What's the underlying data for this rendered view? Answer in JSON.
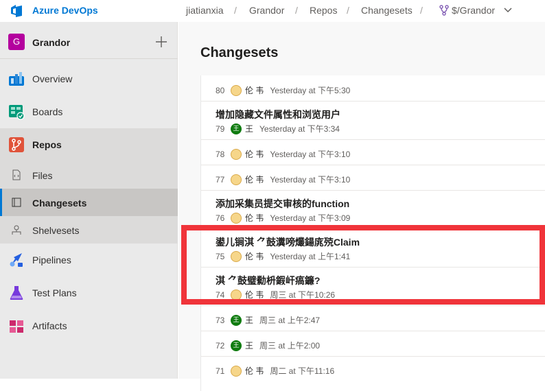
{
  "topbar": {
    "brand": "Azure DevOps",
    "breadcrumbs": [
      "jiatianxia",
      "Grandor",
      "Repos",
      "Changesets",
      "$/Grandor"
    ],
    "separator": "/"
  },
  "sidebar": {
    "project_initial": "G",
    "project_name": "Grandor",
    "items": [
      {
        "label": "Overview",
        "icon": "overview-icon"
      },
      {
        "label": "Boards",
        "icon": "boards-icon"
      },
      {
        "label": "Repos",
        "icon": "repos-icon"
      },
      {
        "label": "Files",
        "icon": "files-icon"
      },
      {
        "label": "Changesets",
        "icon": "changesets-icon"
      },
      {
        "label": "Shelvesets",
        "icon": "shelvesets-icon"
      },
      {
        "label": "Pipelines",
        "icon": "pipelines-icon"
      },
      {
        "label": "Test Plans",
        "icon": "test-plans-icon"
      },
      {
        "label": "Artifacts",
        "icon": "artifacts-icon"
      }
    ],
    "active_item": "Changesets"
  },
  "main": {
    "title": "Changesets",
    "changesets": [
      {
        "id": "80",
        "title": "",
        "author": "伦 韦",
        "avatar": "blonde",
        "when": "Yesterday at 下午5:30"
      },
      {
        "id": "79",
        "title": "增加隐藏文件属性和浏览用户",
        "author": "王",
        "avatar": "green",
        "avatar_text": "王",
        "when": "Yesterday at 下午3:34"
      },
      {
        "id": "78",
        "title": "",
        "author": "伦 韦",
        "avatar": "blonde",
        "when": "Yesterday at 下午3:10"
      },
      {
        "id": "77",
        "title": "",
        "author": "伦 韦",
        "avatar": "blonde",
        "when": "Yesterday at 下午3:10"
      },
      {
        "id": "76",
        "title": "添加采集员提交审核的function",
        "author": "伦 韦",
        "avatar": "blonde",
        "when": "Yesterday at 下午3:09"
      },
      {
        "id": "75",
        "title": "鍙儿锏淇 ⺈鼓瀵嗙爜鍚庣殑Claim",
        "author": "伦 韦",
        "avatar": "blonde",
        "when": "Yesterday at 上午1:41"
      },
      {
        "id": "74",
        "title": "淇 ⺈鼓璧勬枡鍜屽瘑鐮?",
        "author": "伦 韦",
        "avatar": "blonde",
        "when": "周三 at 下午10:26"
      },
      {
        "id": "73",
        "title": "",
        "author": "王",
        "avatar": "green",
        "avatar_text": "王",
        "when": "周三 at 上午2:47"
      },
      {
        "id": "72",
        "title": "",
        "author": "王",
        "avatar": "green",
        "avatar_text": "王",
        "when": "周三 at 上午2:00"
      },
      {
        "id": "71",
        "title": "",
        "author": "伦 韦",
        "avatar": "blonde",
        "when": "周二 at 下午11:16"
      }
    ]
  },
  "colors": {
    "accent": "#0078d4",
    "highlight": "#f0343a",
    "project_avatar": "#b4009e",
    "green_avatar": "#107c10"
  }
}
